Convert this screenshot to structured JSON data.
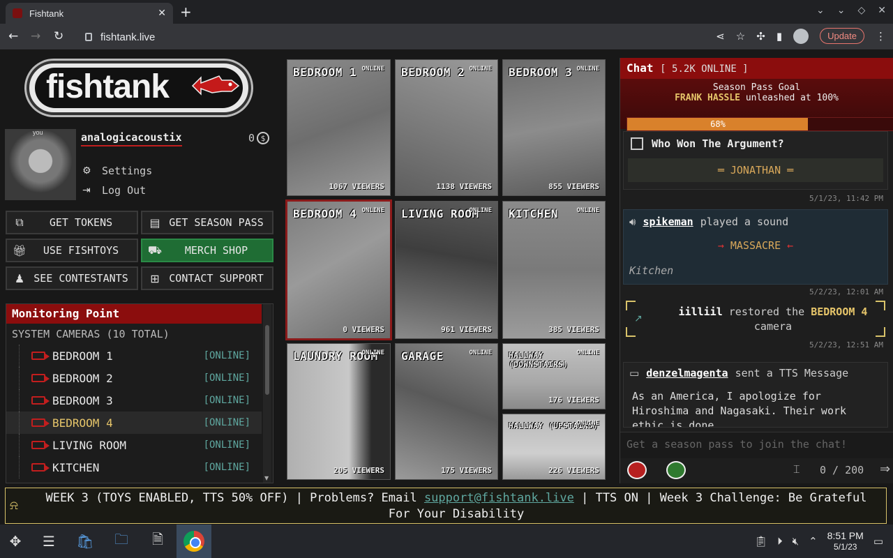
{
  "browser": {
    "tab_title": "Fishtank",
    "url": "fishtank.live",
    "update_label": "Update"
  },
  "logo": {
    "text": "fishtank"
  },
  "profile": {
    "you_label": "you",
    "username": "analogicacoustix",
    "tokens": "0",
    "coin_symbol": "$",
    "settings": "Settings",
    "logout": "Log Out"
  },
  "actions": {
    "get_tokens": "GET TOKENS",
    "get_season_pass": "GET SEASON PASS",
    "use_fishtoys": "USE FISHTOYS",
    "merch_shop": "MERCH SHOP",
    "see_contestants": "SEE CONTESTANTS",
    "contact_support": "CONTACT SUPPORT"
  },
  "monitoring": {
    "title": "Monitoring Point",
    "subtitle": "SYSTEM CAMERAS (10 TOTAL)",
    "cameras": [
      {
        "name": "BEDROOM 1",
        "status": "[ONLINE]"
      },
      {
        "name": "BEDROOM 2",
        "status": "[ONLINE]"
      },
      {
        "name": "BEDROOM 3",
        "status": "[ONLINE]"
      },
      {
        "name": "BEDROOM 4",
        "status": "[ONLINE]"
      },
      {
        "name": "LIVING ROOM",
        "status": "[ONLINE]"
      },
      {
        "name": "KITCHEN",
        "status": "[ONLINE]"
      }
    ]
  },
  "grid": [
    {
      "name": "BEDROOM 1",
      "status": "ONLINE",
      "viewers": "1067 VIEWERS"
    },
    {
      "name": "BEDROOM 2",
      "status": "ONLINE",
      "viewers": "1138 VIEWERS"
    },
    {
      "name": "BEDROOM 3",
      "status": "ONLINE",
      "viewers": "855 VIEWERS"
    },
    {
      "name": "BEDROOM 4",
      "status": "ONLINE",
      "viewers": "0 VIEWERS"
    },
    {
      "name": "LIVING ROOM",
      "status": "ONLINE",
      "viewers": "961 VIEWERS"
    },
    {
      "name": "KITCHEN",
      "status": "ONLINE",
      "viewers": "385 VIEWERS"
    },
    {
      "name": "LAUNDRY ROOM",
      "status": "ONLINE",
      "viewers": "205 VIEWERS"
    },
    {
      "name": "GARAGE",
      "status": "ONLINE",
      "viewers": "175 VIEWERS"
    },
    {
      "name": "HALLWAY (DOWNSTAIRS)",
      "status": "ONLINE",
      "viewers": "176 VIEWERS"
    },
    {
      "name": "HALLWAY (UPSTAIRS)",
      "status": "ONLINE",
      "viewers": "226 VIEWERS"
    }
  ],
  "chat": {
    "title": "Chat",
    "online": "[ 5.2K ONLINE ]",
    "goal_title": "Season Pass Goal",
    "goal_name": "FRANK HASSLE",
    "goal_text": "unleashed at 100%",
    "goal_progress": 0.68,
    "goal_pct_label": "68%",
    "poll_question": "Who Won The Argument?",
    "poll_answer": "═ JONATHAN ═",
    "poll_time": "5/1/23, 11:42 PM",
    "sound_user": "spikeman",
    "sound_action": "played a sound",
    "sound_name": "MASSACRE",
    "sound_room": "Kitchen",
    "sound_time": "5/2/23, 12:01 AM",
    "restore_user": "iilliil",
    "restore_action": "restored the",
    "restore_target": "BEDROOM 4",
    "restore_suffix": "camera",
    "restore_time": "5/2/23, 12:51 AM",
    "tts_user": "denzelmagenta",
    "tts_action": "sent a TTS Message",
    "tts_message": "As an America, I apologize for Hiroshima and Nagasaki. Their work ethic is done.",
    "input_placeholder": "Get a season pass to join the chat!",
    "char_count": "0 / 200"
  },
  "ticker": {
    "text_a": "WEEK 3 (TOYS ENABLED, TTS 50% OFF) | Problems? Email ",
    "email": "support@fishtank.live",
    "text_b": " | TTS ON | Week 3 Challenge: Be Grateful For Your Disability"
  },
  "taskbar": {
    "time": "8:51 PM",
    "date": "5/1/23"
  }
}
